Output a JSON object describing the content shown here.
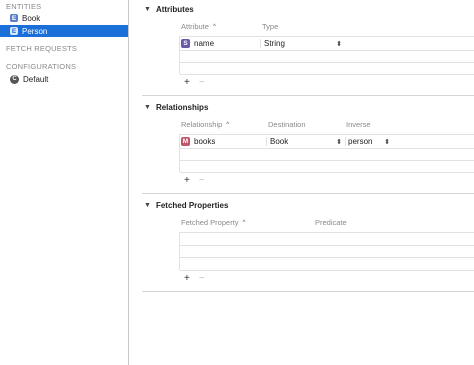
{
  "sidebar": {
    "entities_header": "ENTITIES",
    "entities": [
      {
        "badge": "E",
        "label": "Book",
        "selected": false
      },
      {
        "badge": "E",
        "label": "Person",
        "selected": true
      }
    ],
    "fetch_requests_header": "FETCH REQUESTS",
    "configurations_header": "CONFIGURATIONS",
    "configurations": [
      {
        "badge": "C",
        "label": "Default"
      }
    ]
  },
  "attributes": {
    "title": "Attributes",
    "col_attribute": "Attribute",
    "col_type": "Type",
    "rows": [
      {
        "badge": "S",
        "name": "name",
        "type": "String"
      }
    ]
  },
  "relationships": {
    "title": "Relationships",
    "col_relationship": "Relationship",
    "col_destination": "Destination",
    "col_inverse": "Inverse",
    "rows": [
      {
        "badge": "M",
        "name": "books",
        "destination": "Book",
        "inverse": "person"
      }
    ]
  },
  "fetched_properties": {
    "title": "Fetched Properties",
    "col_fetched_property": "Fetched Property",
    "col_predicate": "Predicate"
  },
  "controls": {
    "add": "+",
    "remove": "−",
    "disclosure": "▼",
    "sort_up": "^",
    "stepper": "⬍"
  }
}
